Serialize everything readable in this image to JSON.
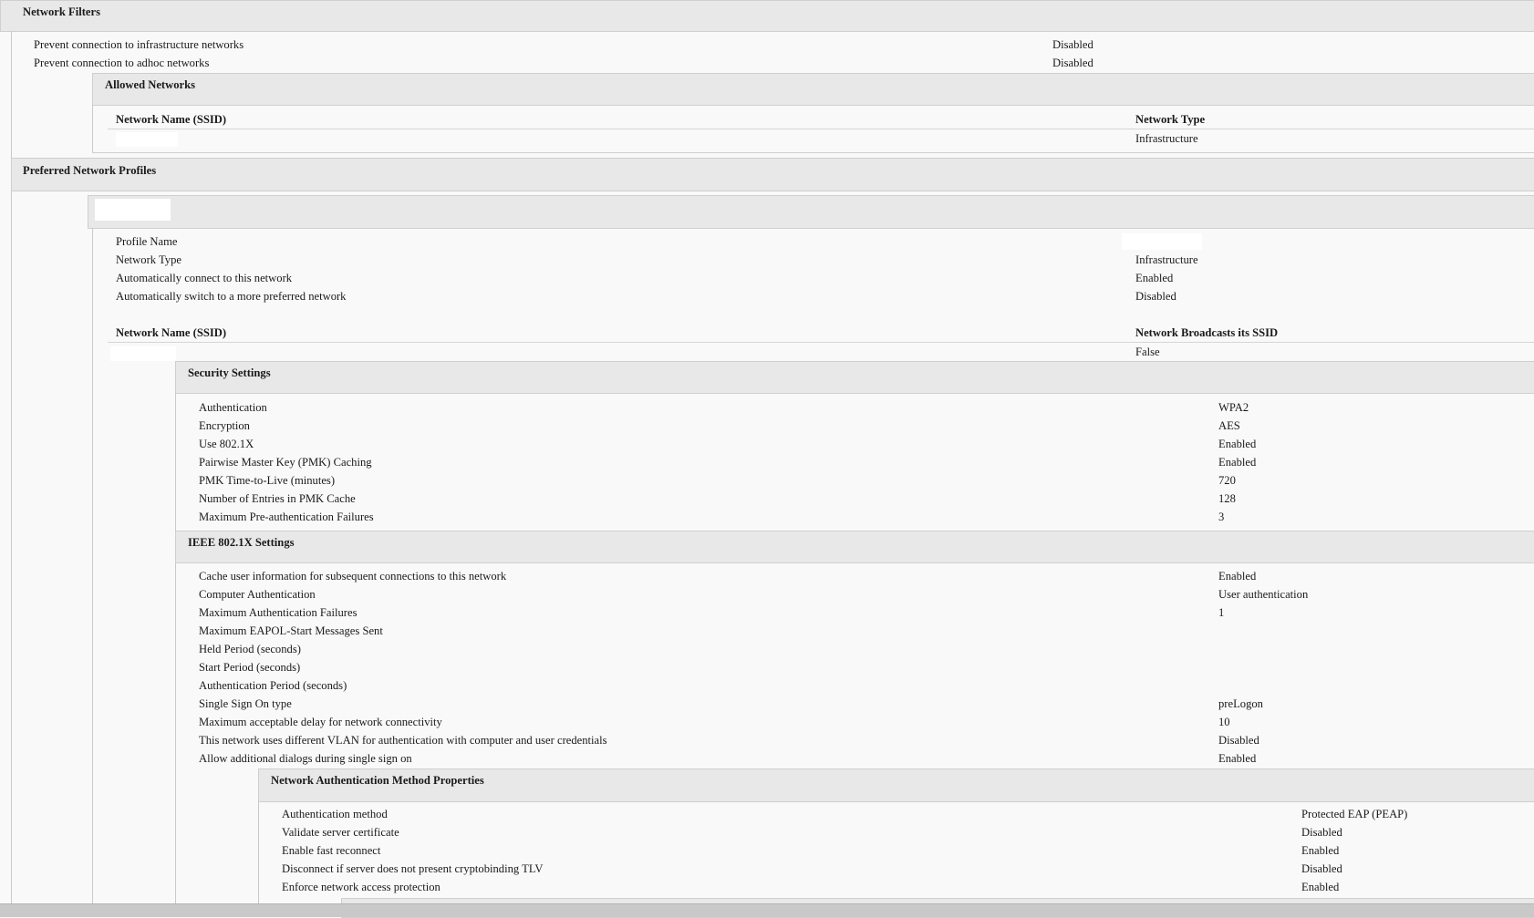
{
  "network_filters": {
    "title": "Network Filters",
    "rows": [
      {
        "label": "Prevent connection to infrastructure networks",
        "value": "Disabled"
      },
      {
        "label": "Prevent connection to adhoc networks",
        "value": "Disabled"
      }
    ],
    "allowed_networks": {
      "title": "Allowed Networks",
      "col_ssid": "Network Name (SSID)",
      "col_type": "Network Type",
      "row_type": "Infrastructure"
    }
  },
  "preferred_profiles": {
    "title": "Preferred Network Profiles",
    "profile": {
      "rows": [
        {
          "label": "Profile Name",
          "value": ""
        },
        {
          "label": "Network Type",
          "value": "Infrastructure"
        },
        {
          "label": "Automatically connect to this network",
          "value": "Enabled"
        },
        {
          "label": "Automatically switch to a more preferred network",
          "value": "Disabled"
        }
      ],
      "col_ssid": "Network Name (SSID)",
      "col_broadcast": "Network Broadcasts its SSID",
      "broadcast_value": "False"
    }
  },
  "security_settings": {
    "title": "Security Settings",
    "rows": [
      {
        "label": "Authentication",
        "value": "WPA2"
      },
      {
        "label": "Encryption",
        "value": "AES"
      },
      {
        "label": "Use 802.1X",
        "value": "Enabled"
      },
      {
        "label": "Pairwise Master Key (PMK) Caching",
        "value": "Enabled"
      },
      {
        "label": "PMK Time-to-Live (minutes)",
        "value": "720"
      },
      {
        "label": "Number of Entries in PMK Cache",
        "value": "128"
      },
      {
        "label": "Maximum Pre-authentication Failures",
        "value": "3"
      }
    ]
  },
  "ieee_settings": {
    "title": "IEEE 802.1X Settings",
    "rows": [
      {
        "label": "Cache user information for subsequent connections to this network",
        "value": "Enabled"
      },
      {
        "label": "Computer Authentication",
        "value": "User authentication"
      },
      {
        "label": "Maximum Authentication Failures",
        "value": "1"
      },
      {
        "label": "Maximum EAPOL-Start Messages Sent",
        "value": ""
      },
      {
        "label": "Held Period (seconds)",
        "value": ""
      },
      {
        "label": "Start Period (seconds)",
        "value": ""
      },
      {
        "label": "Authentication Period (seconds)",
        "value": ""
      },
      {
        "label": "Single Sign On type",
        "value": "preLogon"
      },
      {
        "label": "Maximum acceptable delay for network connectivity",
        "value": "10"
      },
      {
        "label": "This network uses different VLAN for authentication with computer and user credentials",
        "value": "Disabled"
      },
      {
        "label": "Allow additional dialogs during single sign on",
        "value": "Enabled"
      }
    ]
  },
  "auth_method_properties": {
    "title": "Network Authentication Method Properties",
    "rows": [
      {
        "label": "Authentication method",
        "value": "Protected EAP (PEAP)"
      },
      {
        "label": "Validate server certificate",
        "value": "Disabled"
      },
      {
        "label": "Enable fast reconnect",
        "value": "Enabled"
      },
      {
        "label": "Disconnect if server does not present cryptobinding TLV",
        "value": "Disabled"
      },
      {
        "label": "Enforce network access protection",
        "value": "Enabled"
      }
    ]
  }
}
